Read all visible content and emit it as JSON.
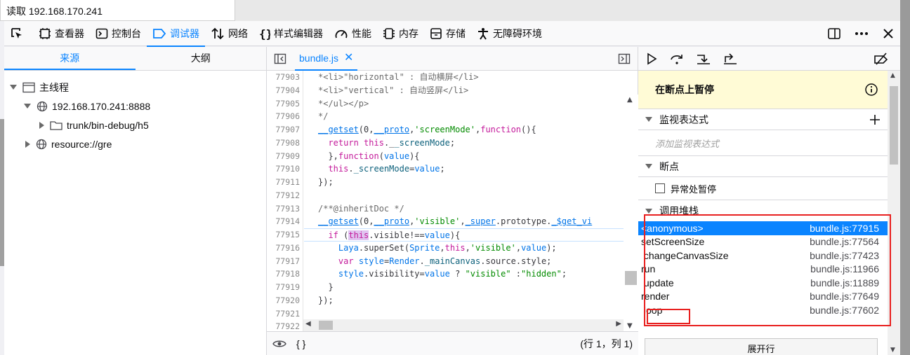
{
  "statusbar": {
    "text": "读取 192.168.170.241"
  },
  "toolbar": {
    "tools": [
      {
        "label": "查看器"
      },
      {
        "label": "控制台"
      },
      {
        "label": "调试器"
      },
      {
        "label": "网络"
      },
      {
        "label": "样式编辑器"
      },
      {
        "label": "性能"
      },
      {
        "label": "内存"
      },
      {
        "label": "存储"
      },
      {
        "label": "无障碍环境"
      }
    ],
    "active": "调试器"
  },
  "sources": {
    "tabs": [
      "来源",
      "大纲"
    ],
    "tree": [
      {
        "label": "主线程"
      },
      {
        "label": "192.168.170.241:8888"
      },
      {
        "label": "trunk/bin-debug/h5"
      },
      {
        "label": "resource://gre"
      }
    ]
  },
  "editor": {
    "tab": "bundle.js",
    "close": "✕",
    "line_numbers": [
      "77903",
      "77904",
      "77905",
      "77906",
      "77907",
      "77908",
      "77909",
      "77910",
      "77911",
      "77912",
      "77913",
      "77914",
      "77915",
      "77916",
      "77917",
      "77918",
      "77919",
      "77920",
      "77921",
      "77922"
    ],
    "footer_left": "{ }",
    "footer_right": "(行 1，列 1)"
  },
  "debugger": {
    "paused": "在断点上暂停",
    "watch": "监视表达式",
    "watch_placeholder": "添加监视表达式",
    "breakpoints": "断点",
    "pause_exceptions": "异常处暂停",
    "callstack": "调用堆栈",
    "frames": [
      {
        "name": "<anonymous>",
        "loc": "bundle.js:77915"
      },
      {
        "name": "setScreenSize",
        "loc": "bundle.js:77564"
      },
      {
        "name": " changeCanvasSize",
        "loc": "bundle.js:77423"
      },
      {
        "name": "run",
        "loc": "bundle.js:11966"
      },
      {
        "name": " update",
        "loc": "bundle.js:11889"
      },
      {
        "name": "render",
        "loc": "bundle.js:77649"
      },
      {
        "name": " loop",
        "loc": "bundle.js:77602"
      }
    ],
    "expand": "展开行"
  }
}
